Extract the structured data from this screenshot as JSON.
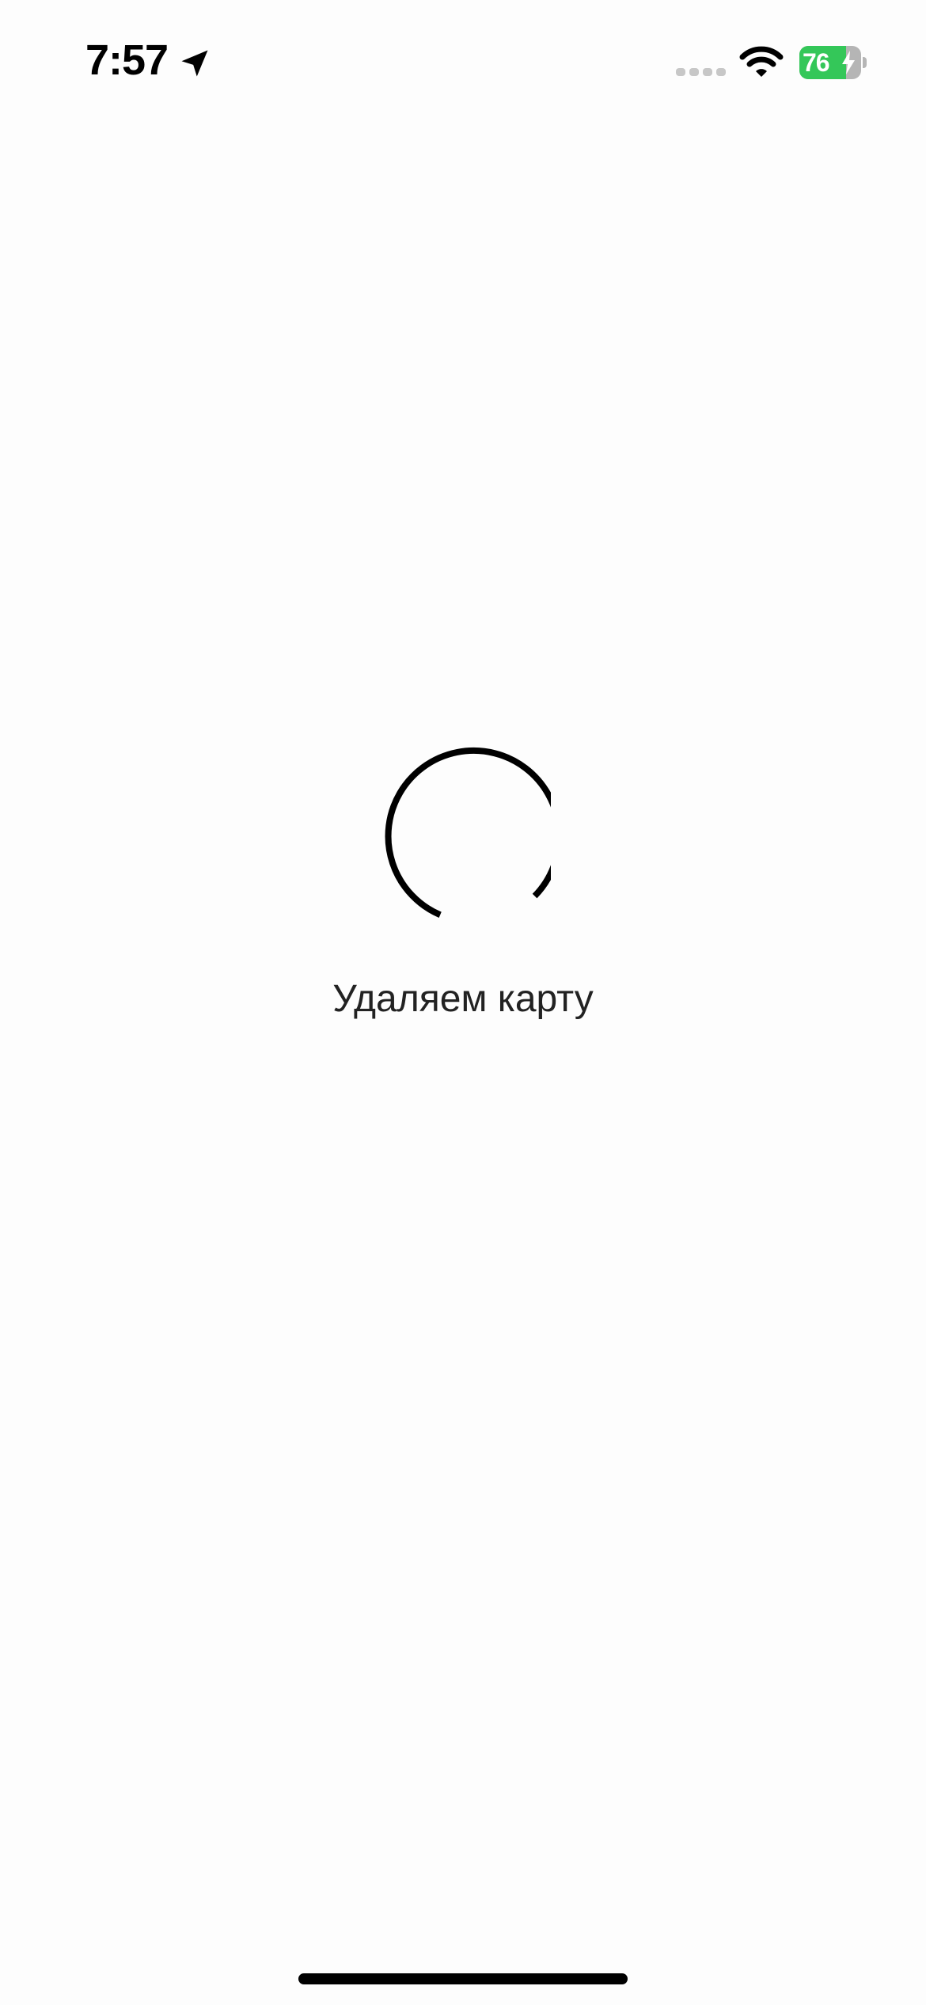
{
  "status_bar": {
    "time": "7:57",
    "location_icon": "location-arrow-icon",
    "signal_icon": "cellular-signal-icon",
    "wifi_icon": "wifi-icon",
    "battery": {
      "percent": 76,
      "label": "76",
      "charging": true,
      "fill_color": "#34c759",
      "empty_color": "#b5b5b5"
    }
  },
  "loader": {
    "icon": "loading-spinner-icon",
    "message": "Удаляем карту"
  },
  "colors": {
    "background": "#fdfdfd",
    "text": "#222222",
    "spinner": "#000000"
  }
}
